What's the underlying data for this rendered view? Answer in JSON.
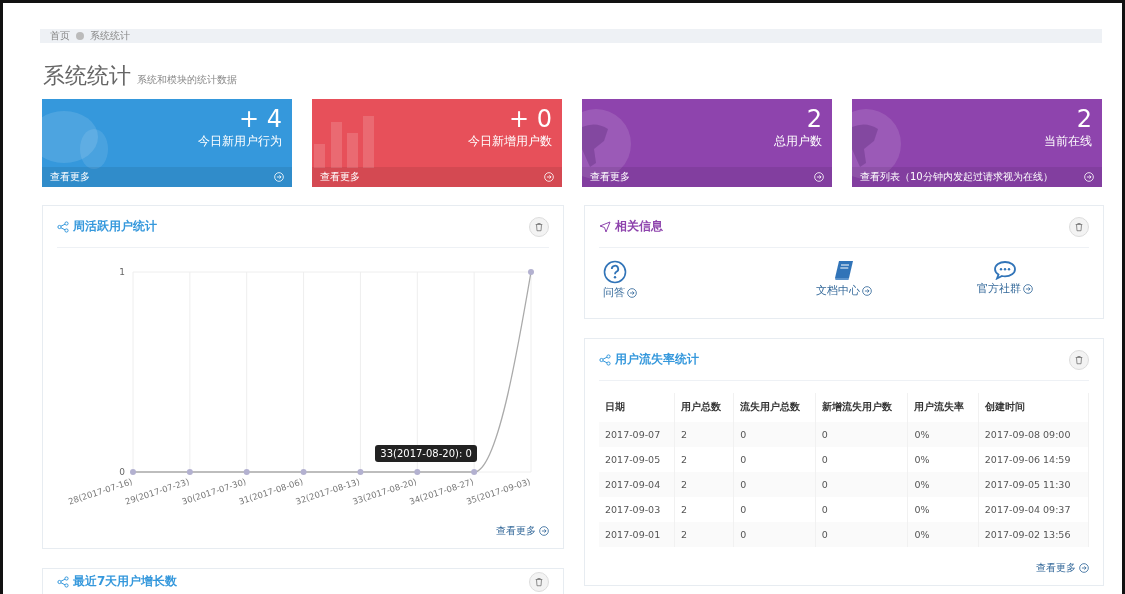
{
  "breadcrumb": [
    {
      "label": "首页"
    },
    {
      "label": "系统统计"
    }
  ],
  "page_title": "系统统计",
  "page_subtitle": "系统和模块的统计数据",
  "stat_cards": [
    {
      "kind": "bubbles",
      "color": "#3598dc",
      "value": "+ 4",
      "label": "今日新用户行为",
      "footer": "查看更多"
    },
    {
      "kind": "bars",
      "color": "#e7505a",
      "value": "+ 0",
      "label": "今日新增用户数",
      "footer": "查看更多"
    },
    {
      "kind": "globe",
      "color": "#8e44ad",
      "value": "2",
      "label": "总用户数",
      "footer": "查看更多"
    },
    {
      "kind": "globe",
      "color": "#8e44ad",
      "value": "2",
      "label": "当前在线",
      "footer": "查看列表（10分钟内发起过请求视为在线）"
    }
  ],
  "weekly_panel": {
    "title": "周活跃用户统计",
    "more": "查看更多",
    "tooltip": "33(2017-08-20): 0",
    "chart_data": {
      "type": "line",
      "categories": [
        "28(2017-07-16)",
        "29(2017-07-23)",
        "30(2017-07-30)",
        "31(2017-08-06)",
        "32(2017-08-13)",
        "33(2017-08-20)",
        "34(2017-08-27)",
        "35(2017-09-03)"
      ],
      "series": [
        {
          "color": "#b3b1d0",
          "marker": true,
          "values": [
            0,
            0,
            0,
            0,
            0,
            0,
            0,
            1
          ]
        }
      ],
      "ylim": [
        0,
        1
      ],
      "yticks": [
        0,
        1
      ],
      "grid": true
    }
  },
  "growth_panel": {
    "title": "最近7天用户增长数"
  },
  "info_panel": {
    "title": "相关信息",
    "links": [
      {
        "kind": "question",
        "label": "问答"
      },
      {
        "kind": "book",
        "label": "文档中心"
      },
      {
        "kind": "chat",
        "label": "官方社群"
      }
    ]
  },
  "churn_panel": {
    "title": "用户流失率统计",
    "more": "查看更多",
    "columns": [
      "日期",
      "用户总数",
      "流失用户总数",
      "新增流失用户数",
      "用户流失率",
      "创建时间"
    ],
    "rows": [
      [
        "2017-09-07",
        "2",
        "0",
        "0",
        "0%",
        "2017-09-08 09:00"
      ],
      [
        "2017-09-05",
        "2",
        "0",
        "0",
        "0%",
        "2017-09-06 14:59"
      ],
      [
        "2017-09-04",
        "2",
        "0",
        "0",
        "0%",
        "2017-09-05 11:30"
      ],
      [
        "2017-09-03",
        "2",
        "0",
        "0",
        "0%",
        "2017-09-04 09:37"
      ],
      [
        "2017-09-01",
        "2",
        "0",
        "0",
        "0%",
        "2017-09-02 13:56"
      ]
    ]
  }
}
